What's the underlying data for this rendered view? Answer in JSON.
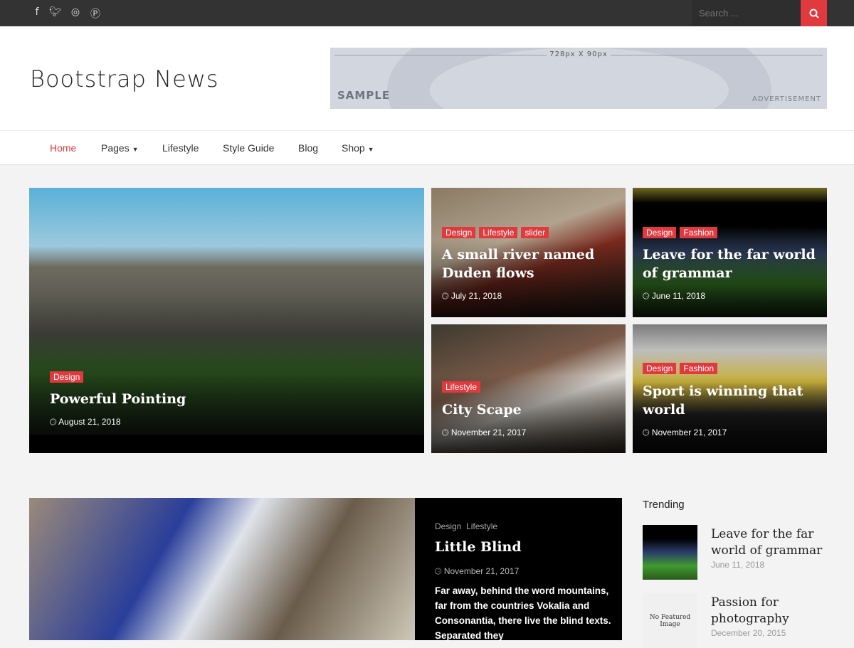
{
  "topbar": {
    "social": [
      "facebook-icon",
      "twitter-icon",
      "instagram-icon",
      "pinterest-icon"
    ],
    "search_placeholder": "Search ...",
    "accent": "#e0393e"
  },
  "header": {
    "logo": "Bootstrap News",
    "ad": {
      "size": "728px X 90px",
      "sample": "SAMPLE",
      "label": "ADVERTISEMENT"
    }
  },
  "nav": [
    {
      "label": "Home",
      "active": true
    },
    {
      "label": "Pages",
      "dropdown": true
    },
    {
      "label": "Lifestyle"
    },
    {
      "label": "Style Guide"
    },
    {
      "label": "Blog"
    },
    {
      "label": "Shop",
      "dropdown": true
    }
  ],
  "featured": [
    {
      "tags": [
        "Design"
      ],
      "title": "Powerful Pointing",
      "date": "August 21, 2018"
    },
    {
      "tags": [
        "Design",
        "Lifestyle",
        "slider"
      ],
      "title": "A small river named Duden flows",
      "date": "July 21, 2018"
    },
    {
      "tags": [
        "Design",
        "Fashion"
      ],
      "title": "Leave for the far world of grammar",
      "date": "June 11, 2018"
    },
    {
      "tags": [
        "Lifestyle"
      ],
      "title": "City Scape",
      "date": "November 21, 2017"
    },
    {
      "tags": [
        "Design",
        "Fashion"
      ],
      "title": "Sport is winning that world",
      "date": "November 21, 2017"
    }
  ],
  "post": {
    "cats": [
      "Design",
      "Lifestyle"
    ],
    "title": "Little Blind",
    "date": "November 21, 2017",
    "excerpt": "Far away, behind the word mountains, far from the countries Vokalia and Consonantia, there live the blind texts. Separated they"
  },
  "trending": {
    "heading": "Trending",
    "items": [
      {
        "title": "Leave for the far world of grammar",
        "date": "June 11, 2018"
      },
      {
        "title": "Passion for photography",
        "date": "December 20, 2015",
        "placeholder": "No Featured Image"
      }
    ]
  }
}
